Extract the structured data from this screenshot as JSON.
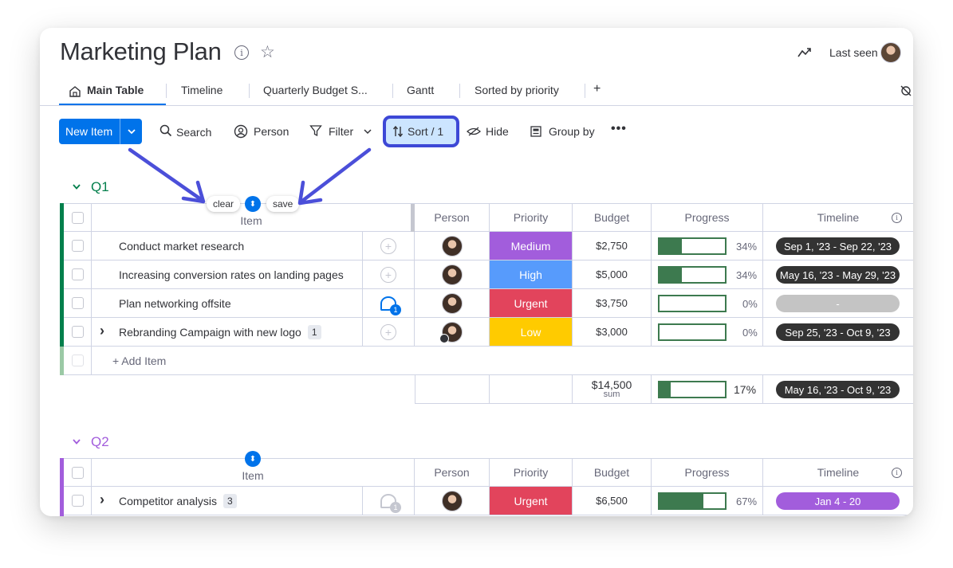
{
  "board": {
    "title": "Marketing Plan",
    "last_seen_label": "Last seen"
  },
  "tabs": [
    {
      "label": "Main Table"
    },
    {
      "label": "Timeline"
    },
    {
      "label": "Quarterly Budget S..."
    },
    {
      "label": "Gantt"
    },
    {
      "label": "Sorted by priority"
    },
    {
      "label": "+"
    }
  ],
  "toolbar": {
    "new_item": "New Item",
    "search": "Search",
    "person": "Person",
    "filter": "Filter",
    "sort": "Sort / 1",
    "hide": "Hide",
    "group_by": "Group by",
    "more": "•••"
  },
  "sort_popover": {
    "clear": "clear",
    "save": "save"
  },
  "columns": [
    "Item",
    "Person",
    "Priority",
    "Budget",
    "Progress",
    "Timeline"
  ],
  "colors": {
    "accent": "#0073ea",
    "q1_group": "#037f4c",
    "q2_group": "#a25ddc",
    "medium": "#a25ddc",
    "high": "#579bfc",
    "urgent": "#e2445c",
    "low": "#fdab3d",
    "progress": "#3d7a4f",
    "timeline_dark": "#333333",
    "timeline_empty": "#c4c4c4",
    "annotation": "#4b4fd9"
  },
  "groups": [
    {
      "title": "Q1",
      "rows": [
        {
          "item": "Conduct market research",
          "priority": "Medium",
          "budget": "$2,750",
          "progress": 34,
          "progress_label": "34%",
          "timeline": "Sep 1, '23 - Sep 22, '23"
        },
        {
          "item": "Increasing conversion rates on landing pages",
          "priority": "High",
          "budget": "$5,000",
          "progress": 34,
          "progress_label": "34%",
          "timeline": "May 16, '23 - May 29, '23"
        },
        {
          "item": "Plan networking offsite",
          "priority": "Urgent",
          "budget": "$3,750",
          "progress": 0,
          "progress_label": "0%",
          "timeline": "-",
          "updates": "1"
        },
        {
          "item": "Rebranding Campaign with new logo",
          "subitems": "1",
          "expand": "›",
          "priority": "Low",
          "budget": "$3,000",
          "progress": 0,
          "progress_label": "0%",
          "timeline": "Sep 25, '23 - Oct 9, '23"
        }
      ],
      "add_item": "+ Add Item",
      "summary": {
        "budget": "$14,500",
        "budget_sub": "sum",
        "progress": 17,
        "progress_label": "17%",
        "timeline": "May 16, '23 - Oct 9, '23"
      }
    },
    {
      "title": "Q2",
      "rows": [
        {
          "item": "Competitor analysis",
          "subitems": "3",
          "expand": "›",
          "priority": "Urgent",
          "budget": "$6,500",
          "progress": 67,
          "progress_label": "67%",
          "timeline": "Jan 4 - 20",
          "updates": "1"
        }
      ]
    }
  ]
}
